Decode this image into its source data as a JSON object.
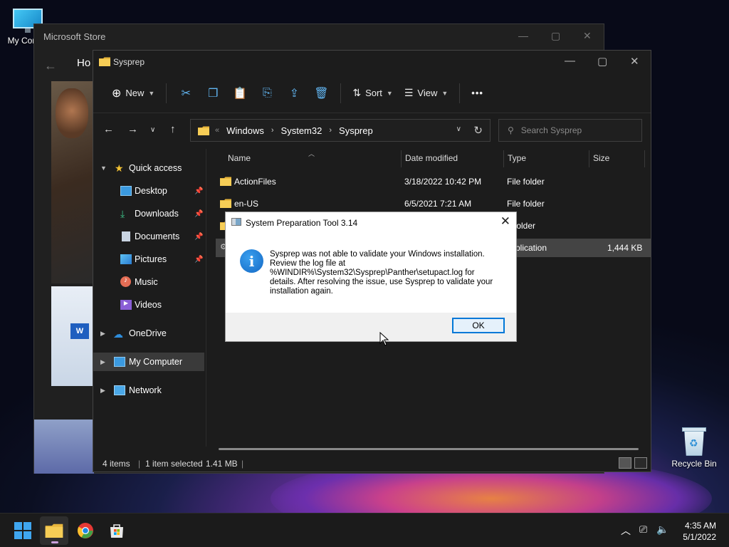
{
  "desktop": {
    "icons": [
      {
        "label": "My Com"
      },
      {
        "label": "Recycle Bin"
      }
    ]
  },
  "store_window": {
    "title": "Microsoft Store",
    "nav_home": "Ho"
  },
  "explorer": {
    "title": "Sysprep",
    "toolbar": {
      "new_label": "New",
      "sort_label": "Sort",
      "view_label": "View",
      "more_label": "•••"
    },
    "address": {
      "overflow": "«",
      "segments": [
        "Windows",
        "System32",
        "Sysprep"
      ]
    },
    "search": {
      "placeholder": "Search Sysprep"
    },
    "nav": {
      "quick_access": "Quick access",
      "items": [
        {
          "label": "Desktop"
        },
        {
          "label": "Downloads"
        },
        {
          "label": "Documents"
        },
        {
          "label": "Pictures"
        },
        {
          "label": "Music"
        },
        {
          "label": "Videos"
        }
      ],
      "onedrive": "OneDrive",
      "my_computer": "My Computer",
      "network": "Network"
    },
    "columns": {
      "name": "Name",
      "date": "Date modified",
      "type": "Type",
      "size": "Size"
    },
    "files": [
      {
        "name": "ActionFiles",
        "date": "3/18/2022 10:42 PM",
        "type": "File folder",
        "size": ""
      },
      {
        "name": "en-US",
        "date": "6/5/2021 7:21 AM",
        "type": "File folder",
        "size": ""
      },
      {
        "name": "",
        "date": "",
        "type": "e folder",
        "size": ""
      },
      {
        "name": "",
        "date": "",
        "type": "plication",
        "size": "1,444 KB"
      }
    ],
    "status": {
      "items": "4 items",
      "selected": "1 item selected",
      "size": "1.41 MB"
    }
  },
  "dialog": {
    "title": "System Preparation Tool 3.14",
    "message": "Sysprep was not able to validate your Windows installation.\nReview the log file at\n%WINDIR%\\System32\\Sysprep\\Panther\\setupact.log for\ndetails. After resolving the issue, use Sysprep to validate your\ninstallation again.",
    "ok_label": "OK"
  },
  "taskbar": {
    "time": "4:35 AM",
    "date": "5/1/2022"
  },
  "colors": {
    "accent": "#0078d7",
    "explorer_bg": "#1c1c1c",
    "taskbar_bg": "#1b1b1b"
  }
}
